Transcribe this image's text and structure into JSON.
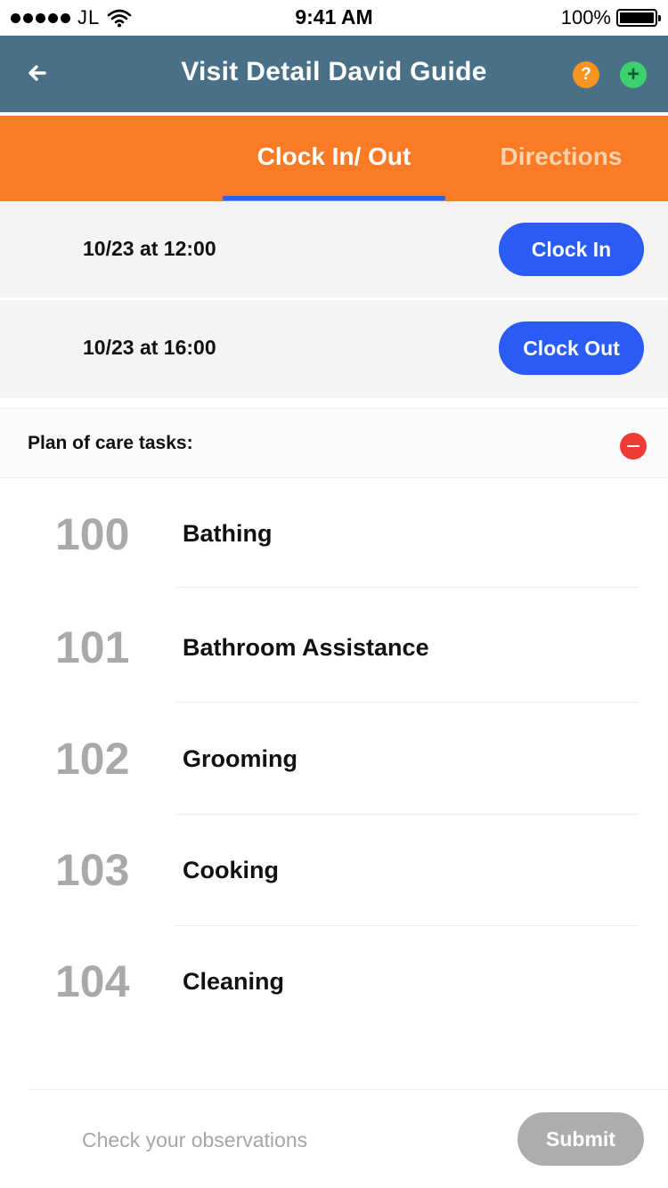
{
  "status_bar": {
    "carrier": "JL",
    "time": "9:41 AM",
    "battery": "100%"
  },
  "header": {
    "title": "Visit Detail David Guide",
    "help_symbol": "?",
    "add_symbol": "+",
    "colors": {
      "background": "#4a7087",
      "help": "#f7941d",
      "add": "#3ecf6e"
    }
  },
  "tabs": {
    "items": [
      {
        "label": "Clock In/ Out",
        "active": true
      },
      {
        "label": "Directions",
        "active": false
      }
    ],
    "colors": {
      "background": "#fb7a26",
      "underline": "#2563eb"
    }
  },
  "clock": {
    "clock_in": {
      "time": "10/23 at 12:00",
      "button": "Clock In"
    },
    "clock_out": {
      "time": "10/23 at 16:00",
      "button": "Clock Out"
    },
    "button_color": "#2a5cf5"
  },
  "plan": {
    "title": "Plan of care tasks:",
    "tasks": [
      {
        "code": "100",
        "name": "Bathing"
      },
      {
        "code": "101",
        "name": "Bathroom Assistance"
      },
      {
        "code": "102",
        "name": "Grooming"
      },
      {
        "code": "103",
        "name": "Cooking"
      },
      {
        "code": "104",
        "name": "Cleaning"
      }
    ]
  },
  "footer": {
    "observations_placeholder": "Check your observations",
    "submit_label": "Submit"
  }
}
